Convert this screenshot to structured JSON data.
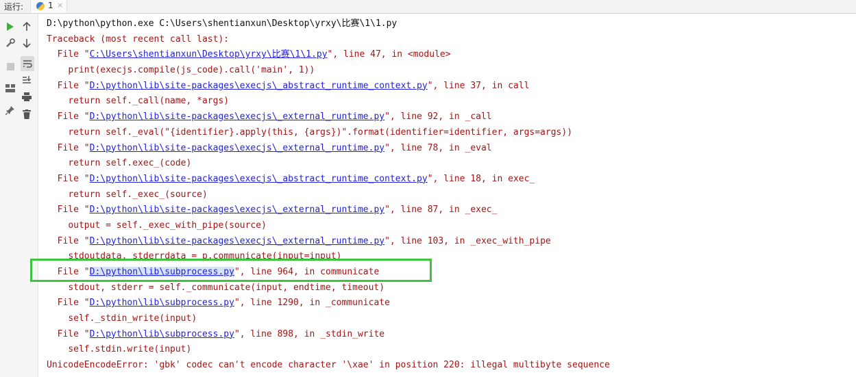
{
  "header": {
    "run_label": "运行:",
    "tab_label": "1",
    "tab_close": "×",
    "tab_icon": "python-icon"
  },
  "toolbar": {
    "icons": [
      "rerun-icon",
      "arrow-up-icon",
      "wrench-icon",
      "arrow-down-icon",
      "stop-icon",
      "soft-wrap-icon",
      "layout-icon",
      "scroll-to-end-icon",
      "pin-icon",
      "print-icon",
      "trash-icon"
    ]
  },
  "console": {
    "command": "D:\\python\\python.exe C:\\Users\\shentianxun\\Desktop\\yrxy\\比赛\\1\\1.py",
    "traceback_header": "Traceback (most recent call last):",
    "frames": [
      {
        "file": "C:\\Users\\shentianxun\\Desktop\\yrxy\\比赛\\1\\1.py",
        "rest": "\", line 47, in <module>",
        "code": "print(execjs.compile(js_code).call('main', 1))"
      },
      {
        "file": "D:\\python\\lib\\site-packages\\execjs\\_abstract_runtime_context.py",
        "rest": "\", line 37, in call",
        "code": "return self._call(name, *args)"
      },
      {
        "file": "D:\\python\\lib\\site-packages\\execjs\\_external_runtime.py",
        "rest": "\", line 92, in _call",
        "code": "return self._eval(\"{identifier}.apply(this, {args})\".format(identifier=identifier, args=args))"
      },
      {
        "file": "D:\\python\\lib\\site-packages\\execjs\\_external_runtime.py",
        "rest": "\", line 78, in _eval",
        "code": "return self.exec_(code)"
      },
      {
        "file": "D:\\python\\lib\\site-packages\\execjs\\_abstract_runtime_context.py",
        "rest": "\", line 18, in exec_",
        "code": "return self._exec_(source)"
      },
      {
        "file": "D:\\python\\lib\\site-packages\\execjs\\_external_runtime.py",
        "rest": "\", line 87, in _exec_",
        "code": "output = self._exec_with_pipe(source)"
      },
      {
        "file": "D:\\python\\lib\\site-packages\\execjs\\_external_runtime.py",
        "rest": "\", line 103, in _exec_with_pipe",
        "code": "stdoutdata, stderrdata = p.communicate(input=input)"
      },
      {
        "file": "D:\\python\\lib\\subprocess.py",
        "rest": "\", line 964, in communicate",
        "code": "stdout, stderr = self._communicate(input, endtime, timeout)"
      },
      {
        "file": "D:\\python\\lib\\subprocess.py",
        "rest": "\", line 1290, in _communicate",
        "code": "self._stdin_write(input)"
      },
      {
        "file": "D:\\python\\lib\\subprocess.py",
        "rest": "\", line 898, in _stdin_write",
        "code": "self.stdin.write(input)"
      }
    ],
    "file_prefix": "  File \"",
    "code_indent": "    ",
    "error": "UnicodeEncodeError: 'gbk' codec can't encode character '\\xae' in position 220: illegal multibyte sequence"
  },
  "colors": {
    "error_text": "#a31515",
    "link": "#2222dd",
    "highlight_box": "#3cc43c",
    "run_green": "#3fae3f"
  }
}
